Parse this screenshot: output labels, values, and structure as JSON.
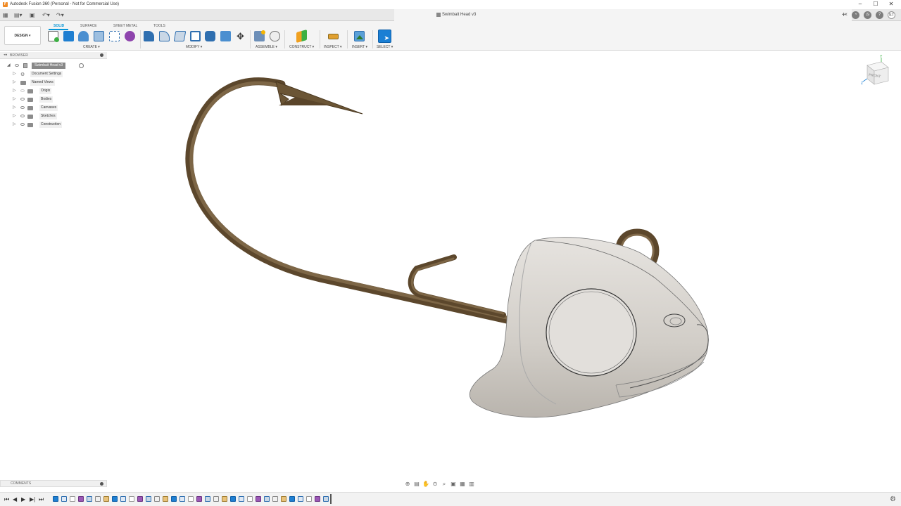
{
  "app": {
    "title": "Autodesk Fusion 360 (Personal - Not for Commercial Use)",
    "icon_letter": "F"
  },
  "document": {
    "tab_title": "Swimbait Head v3",
    "avatar_initials": "ST"
  },
  "toolbar": {
    "design_label": "DESIGN ▾",
    "workspace_tabs": [
      "SOLID",
      "SURFACE",
      "SHEET METAL",
      "TOOLS"
    ],
    "active_tab": "SOLID",
    "groups": {
      "create": "CREATE ▾",
      "modify": "MODIFY ▾",
      "assemble": "ASSEMBLE ▾",
      "construct": "CONSTRUCT ▾",
      "inspect": "INSPECT ▾",
      "insert": "INSERT ▾",
      "select": "SELECT ▾"
    }
  },
  "browser": {
    "title": "BROWSER",
    "root": "Swimbait Head v3",
    "items": [
      {
        "label": "Document Settings",
        "icon": "gear-icon"
      },
      {
        "label": "Named Views",
        "icon": "folder-icon"
      },
      {
        "label": "Origin",
        "icon": "folder-icon"
      },
      {
        "label": "Bodies",
        "icon": "folder-icon"
      },
      {
        "label": "Canvases",
        "icon": "folder-icon"
      },
      {
        "label": "Sketches",
        "icon": "folder-icon"
      },
      {
        "label": "Construction",
        "icon": "folder-icon"
      }
    ]
  },
  "viewcube": {
    "face_label": "FRONT",
    "axis_z": "Z",
    "axis_y": "Y"
  },
  "comments": {
    "title": "COMMENTS"
  },
  "colors": {
    "accent": "#0696d7",
    "hook": "#6e5638",
    "head": "#d2cfca"
  }
}
